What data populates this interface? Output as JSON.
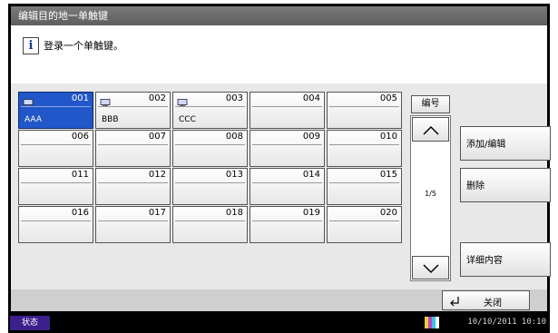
{
  "title": "编辑目的地一单触键",
  "message": "登录一个单触键。",
  "keys": [
    {
      "num": "001",
      "label": "AAA",
      "has_icon": true,
      "selected": true
    },
    {
      "num": "002",
      "label": "BBB",
      "has_icon": true,
      "selected": false
    },
    {
      "num": "003",
      "label": "CCC",
      "has_icon": true,
      "selected": false
    },
    {
      "num": "004",
      "label": "",
      "has_icon": false,
      "selected": false
    },
    {
      "num": "005",
      "label": "",
      "has_icon": false,
      "selected": false
    },
    {
      "num": "006",
      "label": "",
      "has_icon": false,
      "selected": false
    },
    {
      "num": "007",
      "label": "",
      "has_icon": false,
      "selected": false
    },
    {
      "num": "008",
      "label": "",
      "has_icon": false,
      "selected": false
    },
    {
      "num": "009",
      "label": "",
      "has_icon": false,
      "selected": false
    },
    {
      "num": "010",
      "label": "",
      "has_icon": false,
      "selected": false
    },
    {
      "num": "011",
      "label": "",
      "has_icon": false,
      "selected": false
    },
    {
      "num": "012",
      "label": "",
      "has_icon": false,
      "selected": false
    },
    {
      "num": "013",
      "label": "",
      "has_icon": false,
      "selected": false
    },
    {
      "num": "014",
      "label": "",
      "has_icon": false,
      "selected": false
    },
    {
      "num": "015",
      "label": "",
      "has_icon": false,
      "selected": false
    },
    {
      "num": "016",
      "label": "",
      "has_icon": false,
      "selected": false
    },
    {
      "num": "017",
      "label": "",
      "has_icon": false,
      "selected": false
    },
    {
      "num": "018",
      "label": "",
      "has_icon": false,
      "selected": false
    },
    {
      "num": "019",
      "label": "",
      "has_icon": false,
      "selected": false
    },
    {
      "num": "020",
      "label": "",
      "has_icon": false,
      "selected": false
    }
  ],
  "number_button": "编号",
  "page_indicator": "1/5",
  "add_edit_button": "添加/编辑",
  "delete_button": "删除",
  "details_button": "详细内容",
  "close_button": "关闭",
  "status_label": "状态",
  "datetime": "10/10/2011  10:10",
  "colors": {
    "selected_key": "#2157c8",
    "status_tab": "#3c1e8c",
    "title_bar": "#6a6a6a"
  }
}
